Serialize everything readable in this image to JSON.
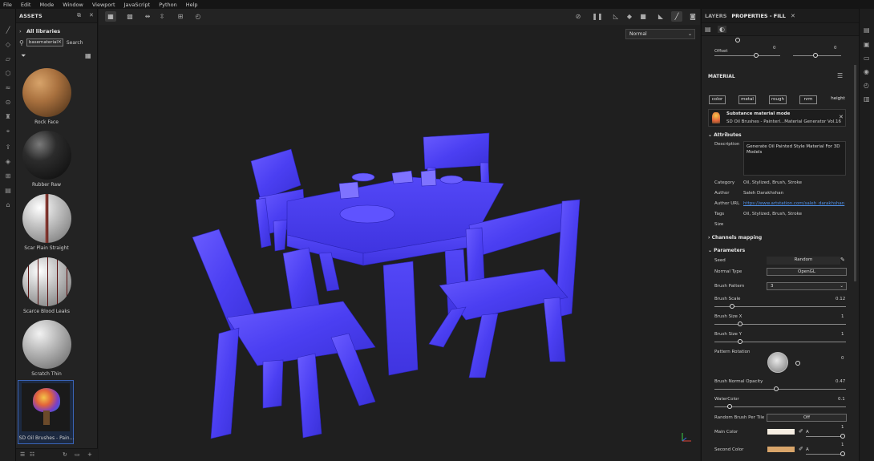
{
  "menu": [
    "File",
    "Edit",
    "Mode",
    "Window",
    "Viewport",
    "JavaScript",
    "Python",
    "Help"
  ],
  "assets": {
    "title": "ASSETS",
    "libraries": "All libraries",
    "search_value": "basematerial",
    "search_button": "Search",
    "items": [
      {
        "label": "Rock Face"
      },
      {
        "label": "Rubber Raw"
      },
      {
        "label": "Scar Plain Straight"
      },
      {
        "label": "Scarce Blood Leaks"
      },
      {
        "label": "Scratch Thin"
      },
      {
        "label": "SD Oil Brushes - Pain..."
      }
    ]
  },
  "viewport": {
    "display_mode": "Normal",
    "tint_color": "#5a4cf5"
  },
  "properties": {
    "tab_layers": "LAYERS",
    "tab_properties": "PROPERTIES - FILL",
    "offset_label": "Offset",
    "offset_values": [
      "0",
      "0"
    ],
    "material_header": "MATERIAL",
    "channels": [
      "color",
      "metal",
      "rough",
      "nrm",
      "height"
    ],
    "substance_mode": "Substance material mode",
    "substance_name": "SD Oil Brushes - Painterl...Material Generator Vol.16",
    "attributes_header": "Attributes",
    "description_label": "Description",
    "description_value": "Generate Oil Painted Style Material For 3D Models",
    "category_label": "Category",
    "category_value": "Oil, Stylized, Brush, Stroke",
    "author_label": "Author",
    "author_value": "Saleh Darakhshan",
    "author_url_label": "Author URL",
    "author_url_value": "https://www.artstation.com/saleh_darakhshan",
    "tags_label": "Tags",
    "tags_value": "Oil, Stylized, Brush, Stroke",
    "size_label": "Size",
    "channels_mapping": "Channels mapping",
    "parameters_header": "Parameters",
    "seed_label": "Seed",
    "seed_value": "Random",
    "normal_type_label": "Normal Type",
    "normal_type_value": "OpenGL",
    "brush_pattern_label": "Brush Pattern",
    "brush_pattern_value": "3",
    "brush_scale_label": "Brush Scale",
    "brush_scale_value": "0.12",
    "brush_size_x_label": "Brush Size X",
    "brush_size_x_value": "1",
    "brush_size_y_label": "Brush Size Y",
    "brush_size_y_value": "1",
    "pattern_rotation_label": "Pattern Rotation",
    "pattern_rotation_value": "0",
    "brush_normal_opacity_label": "Brush Normal Opacity",
    "brush_normal_opacity_value": "0.47",
    "watercolor_label": "WaterColor",
    "watercolor_value": "0.1",
    "random_brush_label": "Random Brush Per Tile",
    "random_brush_value": "Off",
    "main_color_label": "Main Color",
    "main_color_value": "1",
    "main_color_alpha": "A",
    "main_color_hex": "#f6eee2",
    "second_color_label": "Second Color",
    "second_color_value": "1",
    "second_color_alpha": "A",
    "second_color_hex": "#d9a56a"
  }
}
